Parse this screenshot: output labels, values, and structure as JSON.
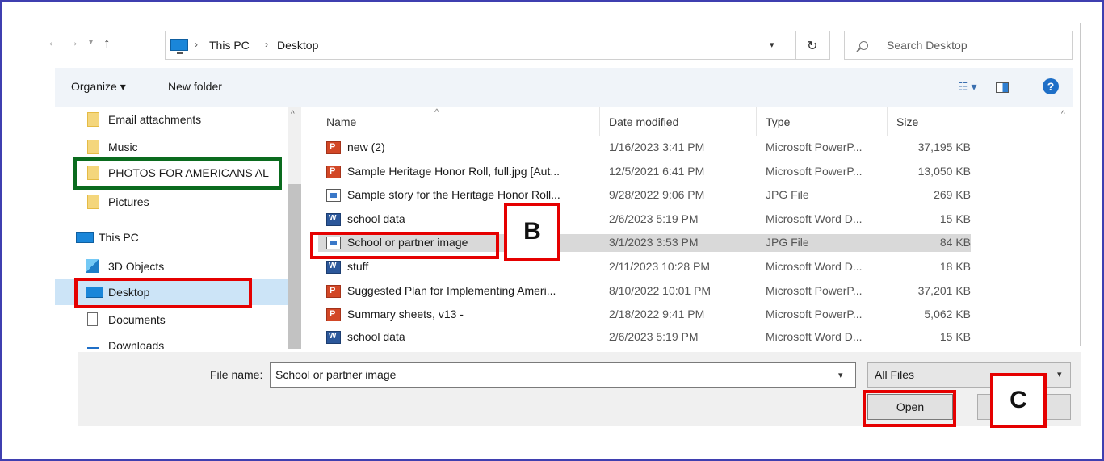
{
  "address": {
    "crumbs": [
      "This PC",
      "Desktop"
    ],
    "separator": "›"
  },
  "search": {
    "placeholder": "Search Desktop"
  },
  "toolbar": {
    "organize": "Organize ▾",
    "new_folder": "New folder",
    "help": "?"
  },
  "nav": {
    "items": [
      {
        "label": "Email attachments",
        "icon": "folder-icon"
      },
      {
        "label": "Music",
        "icon": "folder-icon"
      },
      {
        "label": "PHOTOS FOR AMERICANS AL",
        "icon": "folder-icon"
      },
      {
        "label": "Pictures",
        "icon": "folder-icon"
      },
      {
        "label": "This PC",
        "icon": "computer-icon"
      },
      {
        "label": "3D Objects",
        "icon": "cube-icon"
      },
      {
        "label": "Desktop",
        "icon": "desktop-icon",
        "selected": true
      },
      {
        "label": "Documents",
        "icon": "documents-icon"
      },
      {
        "label": "Downloads",
        "icon": "downloads-icon"
      }
    ]
  },
  "files": {
    "columns": {
      "name": "Name",
      "date": "Date modified",
      "type": "Type",
      "size": "Size"
    },
    "rows": [
      {
        "name": "new (2)",
        "date": "1/16/2023 3:41 PM",
        "type": "Microsoft PowerP...",
        "size": "37,195 KB",
        "icon": "ppt"
      },
      {
        "name": "Sample Heritage Honor Roll, full.jpg [Aut...",
        "date": "12/5/2021 6:41 PM",
        "type": "Microsoft PowerP...",
        "size": "13,050 KB",
        "icon": "ppt"
      },
      {
        "name": "Sample story  for the Heritage Honor Roll...",
        "date": "9/28/2022 9:06 PM",
        "type": "JPG File",
        "size": "269 KB",
        "icon": "jpg"
      },
      {
        "name": "school data",
        "date": "2/6/2023 5:19 PM",
        "type": "Microsoft Word D...",
        "size": "15 KB",
        "icon": "doc"
      },
      {
        "name": "School or partner image",
        "date": "3/1/2023 3:53 PM",
        "type": "JPG File",
        "size": "84 KB",
        "icon": "jpg",
        "selected": true
      },
      {
        "name": "stuff",
        "date": "2/11/2023 10:28 PM",
        "type": "Microsoft Word D...",
        "size": "18 KB",
        "icon": "doc"
      },
      {
        "name": "Suggested Plan for Implementing Ameri...",
        "date": "8/10/2022 10:01 PM",
        "type": "Microsoft PowerP...",
        "size": "37,201 KB",
        "icon": "ppt"
      },
      {
        "name": "Summary sheets, v13 -",
        "date": "2/18/2022 9:41 PM",
        "type": "Microsoft PowerP...",
        "size": "5,062 KB",
        "icon": "ppt"
      },
      {
        "name": "school data",
        "date": "2/6/2023 5:19 PM",
        "type": "Microsoft Word D...",
        "size": "15 KB",
        "icon": "doc"
      }
    ]
  },
  "bottom": {
    "file_name_label": "File name:",
    "file_name_value": "School or partner image",
    "filter": "All Files",
    "open": "Open",
    "cancel": ""
  },
  "annotations": {
    "b": "B",
    "c": "C"
  },
  "colors": {
    "frame": "#3f3fb0",
    "annotation_red": "#e50000",
    "annotation_green": "#0a6b1e",
    "selection": "#d9d9d9"
  }
}
